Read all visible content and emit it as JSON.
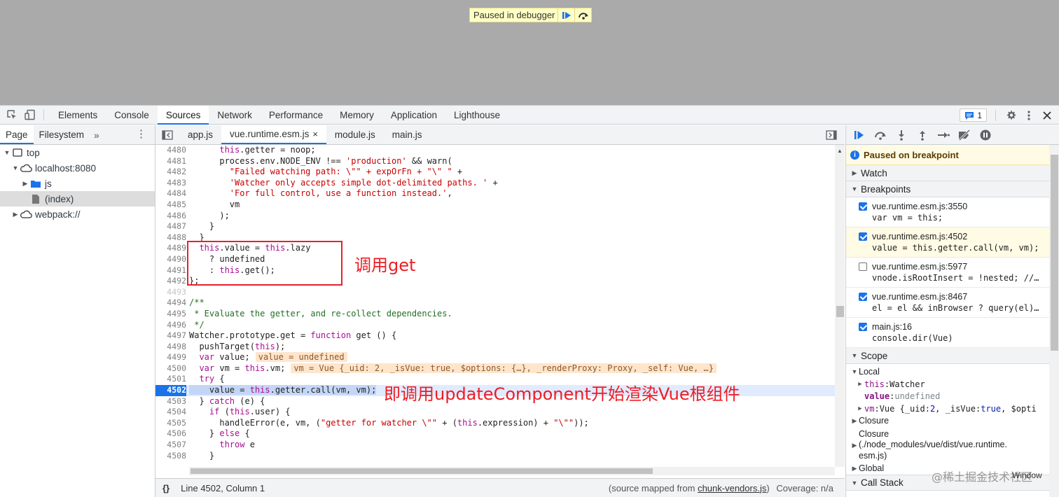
{
  "viewport": {
    "paused_banner": "Paused in debugger"
  },
  "devtools_tabs": [
    "Elements",
    "Console",
    "Sources",
    "Network",
    "Performance",
    "Memory",
    "Application",
    "Lighthouse"
  ],
  "active_devtools_tab": "Sources",
  "issues_count": "1",
  "navigator": {
    "tabs": [
      "Page",
      "Filesystem"
    ],
    "more": "»",
    "tree": {
      "top": "top",
      "host": "localhost:8080",
      "js": "js",
      "index": "(index)",
      "webpack": "webpack://"
    }
  },
  "editor": {
    "tabs": [
      {
        "label": "app.js"
      },
      {
        "label": "vue.runtime.esm.js",
        "close": "×"
      },
      {
        "label": "module.js"
      },
      {
        "label": "main.js"
      }
    ],
    "lines": {
      "n4480": "4480",
      "n4481": "4481",
      "n4482": "4482",
      "n4483": "4483",
      "n4484": "4484",
      "n4485": "4485",
      "n4486": "4486",
      "n4487": "4487",
      "n4488": "4488",
      "n4489": "4489",
      "n4490": "4490",
      "n4491": "4491",
      "n4492": "4492",
      "n4493": "4493",
      "n4494": "4494",
      "n4495": "4495",
      "n4496": "4496",
      "n4497": "4497",
      "n4498": "4498",
      "n4499": "4499",
      "n4500": "4500",
      "n4501": "4501",
      "n4502": "4502",
      "n4503": "4503",
      "n4504": "4504",
      "n4505": "4505",
      "n4506": "4506",
      "n4507": "4507",
      "n4508": "4508"
    },
    "code": {
      "l4480a": "      ",
      "l4480kw": "this",
      "l4480b": ".getter = noop;",
      "l4481a": "      process.env.NODE_ENV !== ",
      "l4481s": "'production'",
      "l4481b": " && warn(",
      "l4482a": "        ",
      "l4482s": "\"Failed watching path: \\\"\" + expOrFn + \"\\\" \"",
      "l4482b": " +",
      "l4483a": "        ",
      "l4483s": "'Watcher only accepts simple dot-delimited paths. '",
      "l4483b": " +",
      "l4484a": "        ",
      "l4484s": "'For full control, use a function instead.'",
      "l4484b": ",",
      "l4485": "        vm",
      "l4486": "      );",
      "l4487": "    }",
      "l4488": "  }",
      "l4489a": "  ",
      "l4489kw1": "this",
      "l4489b": ".value = ",
      "l4489kw2": "this",
      "l4489c": ".lazy",
      "l4490": "    ? undefined",
      "l4491a": "    : ",
      "l4491kw": "this",
      "l4491b": ".get();",
      "l4492": "};",
      "l4494": "/**",
      "l4495": " * Evaluate the getter, and re-collect dependencies.",
      "l4496": " */",
      "l4497a": "Watcher.prototype.get = ",
      "l4497kw": "function",
      "l4497b": " get () {",
      "l4498a": "  pushTarget(",
      "l4498kw": "this",
      "l4498b": ");",
      "l4499a": "  ",
      "l4499kw": "var",
      "l4499b": " value;",
      "l4499v": "value = undefined",
      "l4500a": "  ",
      "l4500kw": "var",
      "l4500b": " vm = ",
      "l4500kw2": "this",
      "l4500c": ".vm;",
      "l4500v": "vm = Vue {_uid: 2, _isVue: true, $options: {…}, _renderProxy: Proxy, _self: Vue, …}",
      "l4501a": "  ",
      "l4501kw": "try",
      "l4501b": " {",
      "l4502a": "    value = ",
      "l4502kw": "this",
      "l4502b": ".getter.call(vm, vm);",
      "l4503a": "  } ",
      "l4503kw": "catch",
      "l4503b": " (e) {",
      "l4504a": "    ",
      "l4504kw": "if",
      "l4504b": " (",
      "l4504kw2": "this",
      "l4504c": ".user) {",
      "l4505a": "      handleError(e, vm, (",
      "l4505s": "\"getter for watcher \\\"\"",
      "l4505b": " + (",
      "l4505kw": "this",
      "l4505c": ".expression) + ",
      "l4505s2": "\"\\\"\"",
      "l4505d": "));",
      "l4506a": "    } ",
      "l4506kw": "else",
      "l4506b": " {",
      "l4507a": "      ",
      "l4507kw": "throw",
      "l4507b": " e",
      "l4508": "    }"
    },
    "annotations": {
      "call_get": "调用get",
      "update_component": "即调用updateComponent开始渲染Vue根组件"
    },
    "status": {
      "braces": "{}",
      "position": "Line 4502, Column 1",
      "source_mapped_prefix": "(source mapped from ",
      "source_mapped_file": "chunk-vendors.js",
      "source_mapped_suffix": ")",
      "coverage": "Coverage: n/a"
    }
  },
  "debugger": {
    "paused_message": "Paused on breakpoint",
    "sections": {
      "watch": "Watch",
      "breakpoints": "Breakpoints",
      "scope": "Scope",
      "call_stack": "Call Stack"
    },
    "breakpoints": [
      {
        "file": "vue.runtime.esm.js:3550",
        "code": "var vm = this;",
        "checked": true,
        "hit": false
      },
      {
        "file": "vue.runtime.esm.js:4502",
        "code": "value = this.getter.call(vm, vm);",
        "checked": true,
        "hit": true
      },
      {
        "file": "vue.runtime.esm.js:5977",
        "code": "vnode.isRootInsert = !nested; //…",
        "checked": false,
        "hit": false
      },
      {
        "file": "vue.runtime.esm.js:8467",
        "code": "el = el && inBrowser ? query(el)…",
        "checked": true,
        "hit": false
      },
      {
        "file": "main.js:16",
        "code": "console.dir(Vue)",
        "checked": true,
        "hit": false
      }
    ],
    "scope": {
      "local": "Local",
      "this_name": "this",
      "this_value": "Watcher",
      "value_name": "value",
      "value_value": "undefined",
      "vm_name": "vm",
      "vm_value_a": "Vue {_uid: ",
      "vm_value_num": "2",
      "vm_value_b": ", _isVue: ",
      "vm_value_bool": "true",
      "vm_value_c": ", $opti",
      "closure1": "Closure",
      "closure2_a": "Closure",
      "closure2_b": "(./node_modules/vue/dist/vue.runtime.",
      "closure2_c": "esm.js)",
      "global": "Global",
      "global_right": "Window"
    }
  },
  "watermark": "@稀土掘金技术社区",
  "colors": {
    "accent": "#1a73e8",
    "annotation_red": "#ee1c25",
    "viewport_gray": "#aaaaaa",
    "paused_yellow": "#ffffc4"
  }
}
